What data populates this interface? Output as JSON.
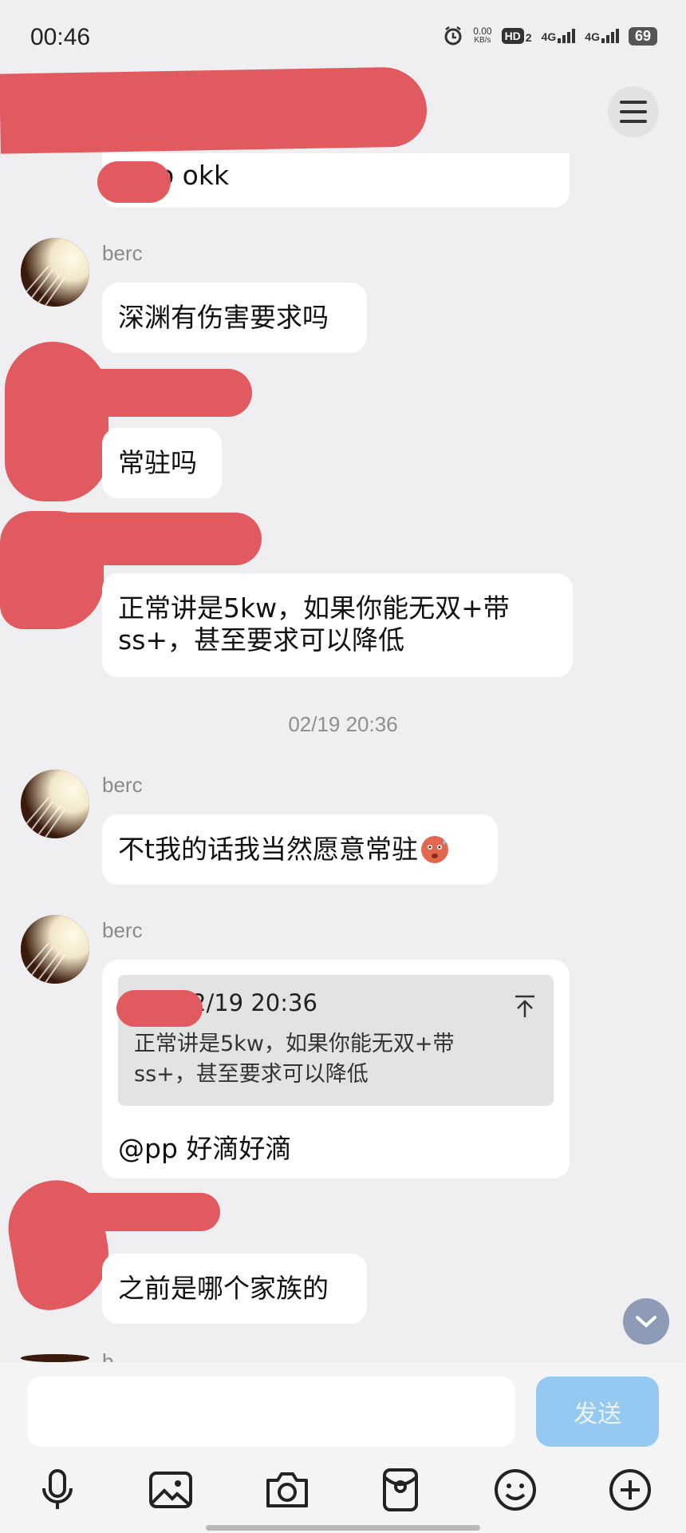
{
  "status_bar": {
    "time": "00:46",
    "speed_value": "0.00",
    "speed_unit": "KB/s",
    "hd_label": "HD",
    "hd_sub": "2",
    "net1": "4G",
    "net2": "4G",
    "battery": "69"
  },
  "messages": {
    "prev_partial": "o okk",
    "m1_sender": "berc",
    "m1_text": "深渊有伤害要求吗",
    "m2_text": "常驻吗",
    "m3_text": "正常讲是5kw，如果你能无双+带ss+，甚至要求可以降低",
    "timestamp": "02/19 20:36",
    "m4_sender": "berc",
    "m4_text": "不t我的话我当然愿意常驻",
    "m5_sender": "berc",
    "m5_quote_time": "2/19 20:36",
    "m5_quote_text": "正常讲是5kw，如果你能无双+带ss+，甚至要求可以降低",
    "m5_text": "@pp 好滴好滴",
    "m6_text": "之前是哪个家族的",
    "m7_sender_partial": "b"
  },
  "input": {
    "placeholder": "",
    "send_label": "发送"
  },
  "toolbar": {
    "icons": [
      "microphone-icon",
      "image-icon",
      "camera-icon",
      "red-packet-icon",
      "emoji-icon",
      "plus-icon"
    ]
  },
  "colors": {
    "redaction": "#e05a60",
    "send_button": "#95c9f1",
    "background": "#efeef0"
  }
}
